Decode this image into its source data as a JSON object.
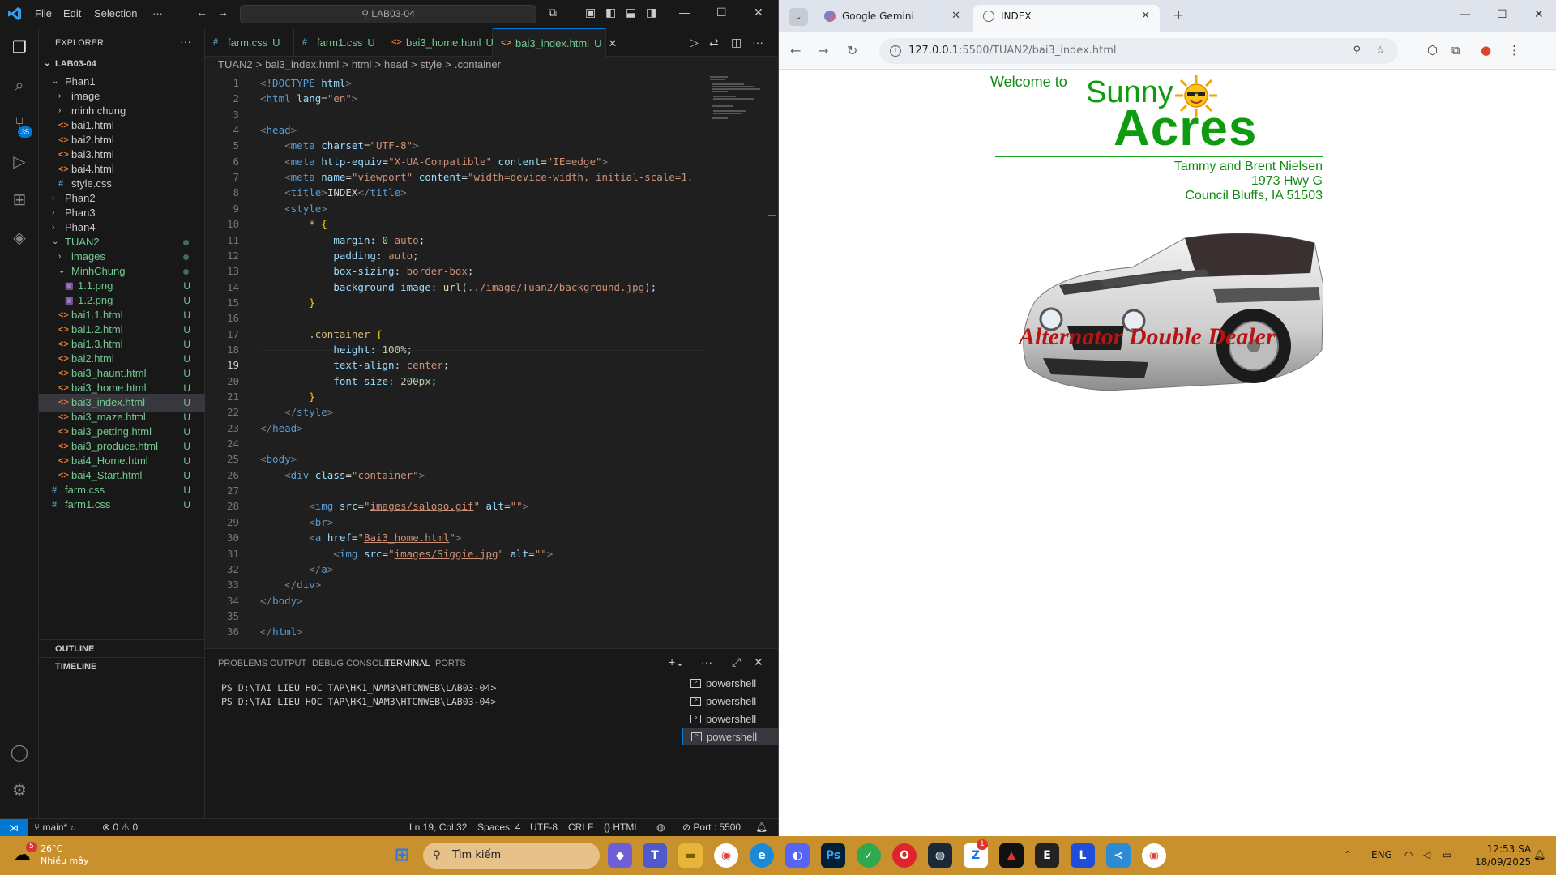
{
  "vscode": {
    "menu": [
      "File",
      "Edit",
      "Selection",
      "···"
    ],
    "command_center": "LAB03-04",
    "activity_badge": "35",
    "explorer": {
      "title": "EXPLORER",
      "root": "LAB03-04",
      "rows": [
        {
          "label": "Phan1",
          "kind": "folder-open",
          "indent": 1,
          "status": ""
        },
        {
          "label": "image",
          "kind": "folder",
          "indent": 2,
          "status": ""
        },
        {
          "label": "minh chung",
          "kind": "folder",
          "indent": 2,
          "status": ""
        },
        {
          "label": "bai1.html",
          "kind": "html",
          "indent": 2,
          "status": ""
        },
        {
          "label": "bai2.html",
          "kind": "html",
          "indent": 2,
          "status": ""
        },
        {
          "label": "bai3.html",
          "kind": "html",
          "indent": 2,
          "status": ""
        },
        {
          "label": "bai4.html",
          "kind": "html",
          "indent": 2,
          "status": ""
        },
        {
          "label": "style.css",
          "kind": "css",
          "indent": 2,
          "status": ""
        },
        {
          "label": "Phan2",
          "kind": "folder",
          "indent": 1,
          "status": ""
        },
        {
          "label": "Phan3",
          "kind": "folder",
          "indent": 1,
          "status": ""
        },
        {
          "label": "Phan4",
          "kind": "folder",
          "indent": 1,
          "status": ""
        },
        {
          "label": "TUAN2",
          "kind": "folder-open-mod",
          "indent": 1,
          "status": "dot"
        },
        {
          "label": "images",
          "kind": "folder-mod",
          "indent": 2,
          "status": "dot"
        },
        {
          "label": "MinhChung",
          "kind": "folder-open-mod",
          "indent": 2,
          "status": "dot"
        },
        {
          "label": "1.1.png",
          "kind": "png",
          "indent": 3,
          "status": "U"
        },
        {
          "label": "1.2.png",
          "kind": "png",
          "indent": 3,
          "status": "U"
        },
        {
          "label": "bai1.1.html",
          "kind": "html-mod",
          "indent": 2,
          "status": "U"
        },
        {
          "label": "bai1.2.html",
          "kind": "html-mod",
          "indent": 2,
          "status": "U"
        },
        {
          "label": "bai1.3.html",
          "kind": "html-mod",
          "indent": 2,
          "status": "U"
        },
        {
          "label": "bai2.html",
          "kind": "html-mod",
          "indent": 2,
          "status": "U"
        },
        {
          "label": "bai3_haunt.html",
          "kind": "html-mod",
          "indent": 2,
          "status": "U"
        },
        {
          "label": "bai3_home.html",
          "kind": "html-mod",
          "indent": 2,
          "status": "U"
        },
        {
          "label": "bai3_index.html",
          "kind": "html-mod",
          "indent": 2,
          "status": "U",
          "selected": true
        },
        {
          "label": "bai3_maze.html",
          "kind": "html-mod",
          "indent": 2,
          "status": "U"
        },
        {
          "label": "bai3_petting.html",
          "kind": "html-mod",
          "indent": 2,
          "status": "U"
        },
        {
          "label": "bai3_produce.html",
          "kind": "html-mod",
          "indent": 2,
          "status": "U"
        },
        {
          "label": "bai4_Home.html",
          "kind": "html-mod",
          "indent": 2,
          "status": "U"
        },
        {
          "label": "bai4_Start.html",
          "kind": "html-mod",
          "indent": 2,
          "status": "U"
        },
        {
          "label": "farm.css",
          "kind": "css-mod",
          "indent": 1,
          "status": "U"
        },
        {
          "label": "farm1.css",
          "kind": "css-mod",
          "indent": 1,
          "status": "U"
        }
      ],
      "outline": "OUTLINE",
      "timeline": "TIMELINE"
    },
    "tabs": [
      {
        "label": "farm.css",
        "icon": "#",
        "status": "U"
      },
      {
        "label": "farm1.css",
        "icon": "#",
        "status": "U"
      },
      {
        "label": "bai3_home.html",
        "icon": "<>",
        "status": "U"
      },
      {
        "label": "bai3_index.html",
        "icon": "<>",
        "status": "U",
        "active": true
      }
    ],
    "breadcrumbs": [
      "TUAN2",
      ">",
      "bai3_index.html",
      ">",
      "html",
      ">",
      "head",
      ">",
      "style",
      ">",
      ".container"
    ],
    "current_line": 19,
    "code_lines": [
      [
        [
          "t-pun",
          "<"
        ],
        [
          "t-tag",
          "!DOCTYPE "
        ],
        [
          "t-attr",
          "html"
        ],
        [
          "t-pun",
          ">"
        ]
      ],
      [
        [
          "t-pun",
          "<"
        ],
        [
          "t-tag",
          "html "
        ],
        [
          "t-attr",
          "lang"
        ],
        [
          "t-txt",
          "="
        ],
        [
          "t-str",
          "\"en\""
        ],
        [
          "t-pun",
          ">"
        ]
      ],
      [],
      [
        [
          "t-pun",
          "<"
        ],
        [
          "t-tag",
          "head"
        ],
        [
          "t-pun",
          ">"
        ]
      ],
      [
        [
          "t-txt",
          "    "
        ],
        [
          "t-pun",
          "<"
        ],
        [
          "t-tag",
          "meta "
        ],
        [
          "t-attr",
          "charset"
        ],
        [
          "t-txt",
          "="
        ],
        [
          "t-str",
          "\"UTF-8\""
        ],
        [
          "t-pun",
          ">"
        ]
      ],
      [
        [
          "t-txt",
          "    "
        ],
        [
          "t-pun",
          "<"
        ],
        [
          "t-tag",
          "meta "
        ],
        [
          "t-attr",
          "http-equiv"
        ],
        [
          "t-txt",
          "="
        ],
        [
          "t-str",
          "\"X-UA-Compatible\" "
        ],
        [
          "t-attr",
          "content"
        ],
        [
          "t-txt",
          "="
        ],
        [
          "t-str",
          "\"IE=edge\""
        ],
        [
          "t-pun",
          ">"
        ]
      ],
      [
        [
          "t-txt",
          "    "
        ],
        [
          "t-pun",
          "<"
        ],
        [
          "t-tag",
          "meta "
        ],
        [
          "t-attr",
          "name"
        ],
        [
          "t-txt",
          "="
        ],
        [
          "t-str",
          "\"viewport\" "
        ],
        [
          "t-attr",
          "content"
        ],
        [
          "t-txt",
          "="
        ],
        [
          "t-str",
          "\"width=device-width, initial-scale=1."
        ]
      ],
      [
        [
          "t-txt",
          "    "
        ],
        [
          "t-pun",
          "<"
        ],
        [
          "t-tag",
          "title"
        ],
        [
          "t-pun",
          ">"
        ],
        [
          "t-txt",
          "INDEX"
        ],
        [
          "t-pun",
          "</"
        ],
        [
          "t-tag",
          "title"
        ],
        [
          "t-pun",
          ">"
        ]
      ],
      [
        [
          "t-txt",
          "    "
        ],
        [
          "t-pun",
          "<"
        ],
        [
          "t-tag",
          "style"
        ],
        [
          "t-pun",
          ">"
        ]
      ],
      [
        [
          "t-txt",
          "        "
        ],
        [
          "t-sel",
          "* "
        ],
        [
          "t-br",
          "{"
        ]
      ],
      [
        [
          "t-txt",
          "            "
        ],
        [
          "t-prop",
          "margin"
        ],
        [
          "t-txt",
          ": "
        ],
        [
          "t-num",
          "0 "
        ],
        [
          "t-str",
          "auto"
        ],
        [
          "t-txt",
          ";"
        ]
      ],
      [
        [
          "t-txt",
          "            "
        ],
        [
          "t-prop",
          "padding"
        ],
        [
          "t-txt",
          ": "
        ],
        [
          "t-str",
          "auto"
        ],
        [
          "t-txt",
          ";"
        ]
      ],
      [
        [
          "t-txt",
          "            "
        ],
        [
          "t-prop",
          "box-sizing"
        ],
        [
          "t-txt",
          ": "
        ],
        [
          "t-str",
          "border-box"
        ],
        [
          "t-txt",
          ";"
        ]
      ],
      [
        [
          "t-txt",
          "            "
        ],
        [
          "t-prop",
          "background-image"
        ],
        [
          "t-txt",
          ": "
        ],
        [
          "t-fn",
          "url"
        ],
        [
          "t-txt",
          "("
        ],
        [
          "t-str",
          "../image/Tuan2/background.jpg"
        ],
        [
          "t-txt",
          ");"
        ]
      ],
      [
        [
          "t-txt",
          "        "
        ],
        [
          "t-br",
          "}"
        ]
      ],
      [],
      [
        [
          "t-txt",
          "        "
        ],
        [
          "t-sel",
          ".container "
        ],
        [
          "t-br",
          "{"
        ]
      ],
      [
        [
          "t-txt",
          "            "
        ],
        [
          "t-prop",
          "height"
        ],
        [
          "t-txt",
          ": "
        ],
        [
          "t-num",
          "100%"
        ],
        [
          "t-txt",
          ";"
        ]
      ],
      [
        [
          "t-txt",
          "            "
        ],
        [
          "t-prop",
          "text-align"
        ],
        [
          "t-txt",
          ": "
        ],
        [
          "t-str",
          "center"
        ],
        [
          "t-txt",
          ";"
        ]
      ],
      [
        [
          "t-txt",
          "            "
        ],
        [
          "t-prop",
          "font-size"
        ],
        [
          "t-txt",
          ": "
        ],
        [
          "t-num",
          "200px"
        ],
        [
          "t-txt",
          ";"
        ]
      ],
      [
        [
          "t-txt",
          "        "
        ],
        [
          "t-br",
          "}"
        ]
      ],
      [
        [
          "t-txt",
          "    "
        ],
        [
          "t-pun",
          "</"
        ],
        [
          "t-tag",
          "style"
        ],
        [
          "t-pun",
          ">"
        ]
      ],
      [
        [
          "t-pun",
          "</"
        ],
        [
          "t-tag",
          "head"
        ],
        [
          "t-pun",
          ">"
        ]
      ],
      [],
      [
        [
          "t-pun",
          "<"
        ],
        [
          "t-tag",
          "body"
        ],
        [
          "t-pun",
          ">"
        ]
      ],
      [
        [
          "t-txt",
          "    "
        ],
        [
          "t-pun",
          "<"
        ],
        [
          "t-tag",
          "div "
        ],
        [
          "t-attr",
          "class"
        ],
        [
          "t-txt",
          "="
        ],
        [
          "t-str",
          "\"container\""
        ],
        [
          "t-pun",
          ">"
        ]
      ],
      [],
      [
        [
          "t-txt",
          "        "
        ],
        [
          "t-pun",
          "<"
        ],
        [
          "t-tag",
          "img "
        ],
        [
          "t-attr",
          "src"
        ],
        [
          "t-txt",
          "="
        ],
        [
          "t-str",
          "\""
        ],
        [
          "t-str t-ul",
          "images/salogo.gif"
        ],
        [
          "t-str",
          "\" "
        ],
        [
          "t-attr",
          "alt"
        ],
        [
          "t-txt",
          "="
        ],
        [
          "t-str",
          "\"\""
        ],
        [
          "t-pun",
          ">"
        ]
      ],
      [
        [
          "t-txt",
          "        "
        ],
        [
          "t-pun",
          "<"
        ],
        [
          "t-tag",
          "br"
        ],
        [
          "t-pun",
          ">"
        ]
      ],
      [
        [
          "t-txt",
          "        "
        ],
        [
          "t-pun",
          "<"
        ],
        [
          "t-tag",
          "a "
        ],
        [
          "t-attr",
          "href"
        ],
        [
          "t-txt",
          "="
        ],
        [
          "t-str",
          "\""
        ],
        [
          "t-str t-ul",
          "Bai3_home.html"
        ],
        [
          "t-str",
          "\""
        ],
        [
          "t-pun",
          ">"
        ]
      ],
      [
        [
          "t-txt",
          "            "
        ],
        [
          "t-pun",
          "<"
        ],
        [
          "t-tag",
          "img "
        ],
        [
          "t-attr",
          "src"
        ],
        [
          "t-txt",
          "="
        ],
        [
          "t-str",
          "\""
        ],
        [
          "t-str t-ul",
          "images/Siggie.jpg"
        ],
        [
          "t-str",
          "\" "
        ],
        [
          "t-attr",
          "alt"
        ],
        [
          "t-txt",
          "="
        ],
        [
          "t-str",
          "\"\""
        ],
        [
          "t-pun",
          ">"
        ]
      ],
      [
        [
          "t-txt",
          "        "
        ],
        [
          "t-pun",
          "</"
        ],
        [
          "t-tag",
          "a"
        ],
        [
          "t-pun",
          ">"
        ]
      ],
      [
        [
          "t-txt",
          "    "
        ],
        [
          "t-pun",
          "</"
        ],
        [
          "t-tag",
          "div"
        ],
        [
          "t-pun",
          ">"
        ]
      ],
      [
        [
          "t-pun",
          "</"
        ],
        [
          "t-tag",
          "body"
        ],
        [
          "t-pun",
          ">"
        ]
      ],
      [],
      [
        [
          "t-pun",
          "</"
        ],
        [
          "t-tag",
          "html"
        ],
        [
          "t-pun",
          ">"
        ]
      ]
    ],
    "panel": {
      "tabs": [
        "PROBLEMS",
        "OUTPUT",
        "DEBUG CONSOLE",
        "TERMINAL",
        "PORTS"
      ],
      "active_tab": "TERMINAL",
      "terminal_lines": [
        "PS D:\\TAI LIEU HOC TAP\\HK1_NAM3\\HTCNWEB\\LAB03-04>",
        "PS D:\\TAI LIEU HOC TAP\\HK1_NAM3\\HTCNWEB\\LAB03-04>"
      ],
      "terminals": [
        "powershell",
        "powershell",
        "powershell",
        "powershell"
      ]
    },
    "status": {
      "branch": "main*",
      "errors": "0",
      "warnings": "0",
      "position": "Ln 19, Col 32",
      "spaces": "Spaces: 4",
      "encoding": "UTF-8",
      "eol": "CRLF",
      "language": "HTML",
      "port": "Port : 5500"
    }
  },
  "browser": {
    "tabs": [
      {
        "label": "Google Gemini"
      },
      {
        "label": "INDEX",
        "active": true
      }
    ],
    "url_host": "127.0.0.1",
    "url_path": ":5500/TUAN2/bai3_index.html",
    "page": {
      "welcome": "Welcome to",
      "sunny": "Sunny",
      "acres": "Acres",
      "address": [
        "Tammy and Brent Nielsen",
        "1973 Hwy G",
        "Council Bluffs, IA  51503"
      ],
      "car_caption": "Alternator Double Dealer"
    }
  },
  "taskbar": {
    "weather_temp": "26°C",
    "weather_desc": "Nhiều mây",
    "weather_badge": "5",
    "search": "Tìm kiếm",
    "lang": "ENG",
    "time": "12:53 SA",
    "date": "18/09/2025",
    "zalo_badge": "1"
  },
  "colors": {
    "accent": "#0078d4",
    "vscode_bg": "#1f1f1f",
    "green_logo": "#0f9b0f",
    "caption_red": "#b81414",
    "taskbar": "#c9902e",
    "modified_green": "#73c991",
    "html_icon": "#e37933",
    "css_icon": "#519aba"
  }
}
